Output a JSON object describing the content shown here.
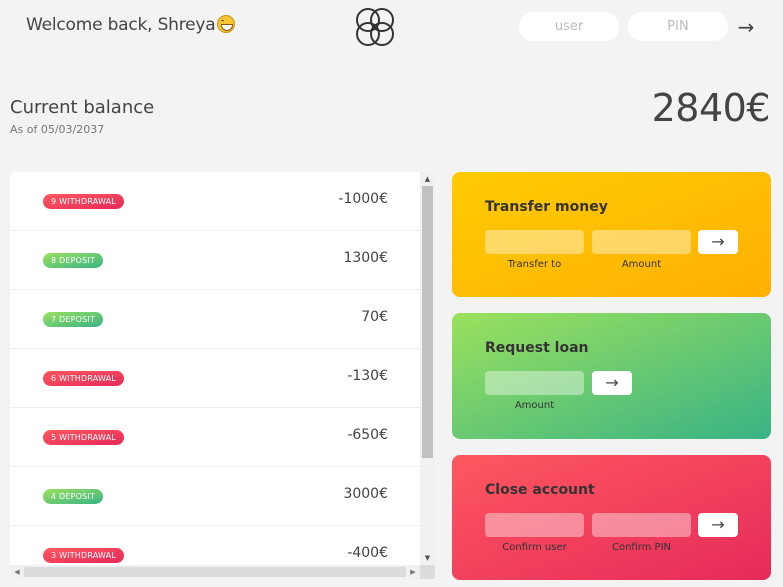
{
  "nav": {
    "welcome": "Welcome back, Shreya",
    "login_user_placeholder": "user",
    "login_pin_placeholder": "PIN",
    "login_button": "→",
    "icons": {
      "emoji": "grinning-face-emoji",
      "logo": "four-circles-logo",
      "login": "arrow-right-icon"
    }
  },
  "balance": {
    "label": "Current balance",
    "date_text": "As of 05/03/2037",
    "value": "2840€"
  },
  "movements": [
    {
      "type_label": "9 WITHDRAWAL",
      "kind": "withdrawal",
      "amount": "-1000€"
    },
    {
      "type_label": "8 DEPOSIT",
      "kind": "deposit",
      "amount": "1300€"
    },
    {
      "type_label": "7 DEPOSIT",
      "kind": "deposit",
      "amount": "70€"
    },
    {
      "type_label": "6 WITHDRAWAL",
      "kind": "withdrawal",
      "amount": "-130€"
    },
    {
      "type_label": "5 WITHDRAWAL",
      "kind": "withdrawal",
      "amount": "-650€"
    },
    {
      "type_label": "4 DEPOSIT",
      "kind": "deposit",
      "amount": "3000€"
    },
    {
      "type_label": "3 WITHDRAWAL",
      "kind": "withdrawal",
      "amount": "-400€"
    }
  ],
  "operations": {
    "transfer": {
      "title": "Transfer money",
      "label_to": "Transfer to",
      "label_amount": "Amount",
      "button": "→"
    },
    "loan": {
      "title": "Request loan",
      "label_amount": "Amount",
      "button": "→"
    },
    "close": {
      "title": "Close account",
      "label_user": "Confirm user",
      "label_pin": "Confirm PIN",
      "button": "→"
    }
  },
  "colors": {
    "background": "#f3f3f3",
    "withdrawal": "#e52a5a",
    "deposit": "#39b385",
    "transfer_card": "#ffb003",
    "loan_card": "#9be15d",
    "close_card": "#ff585f"
  }
}
